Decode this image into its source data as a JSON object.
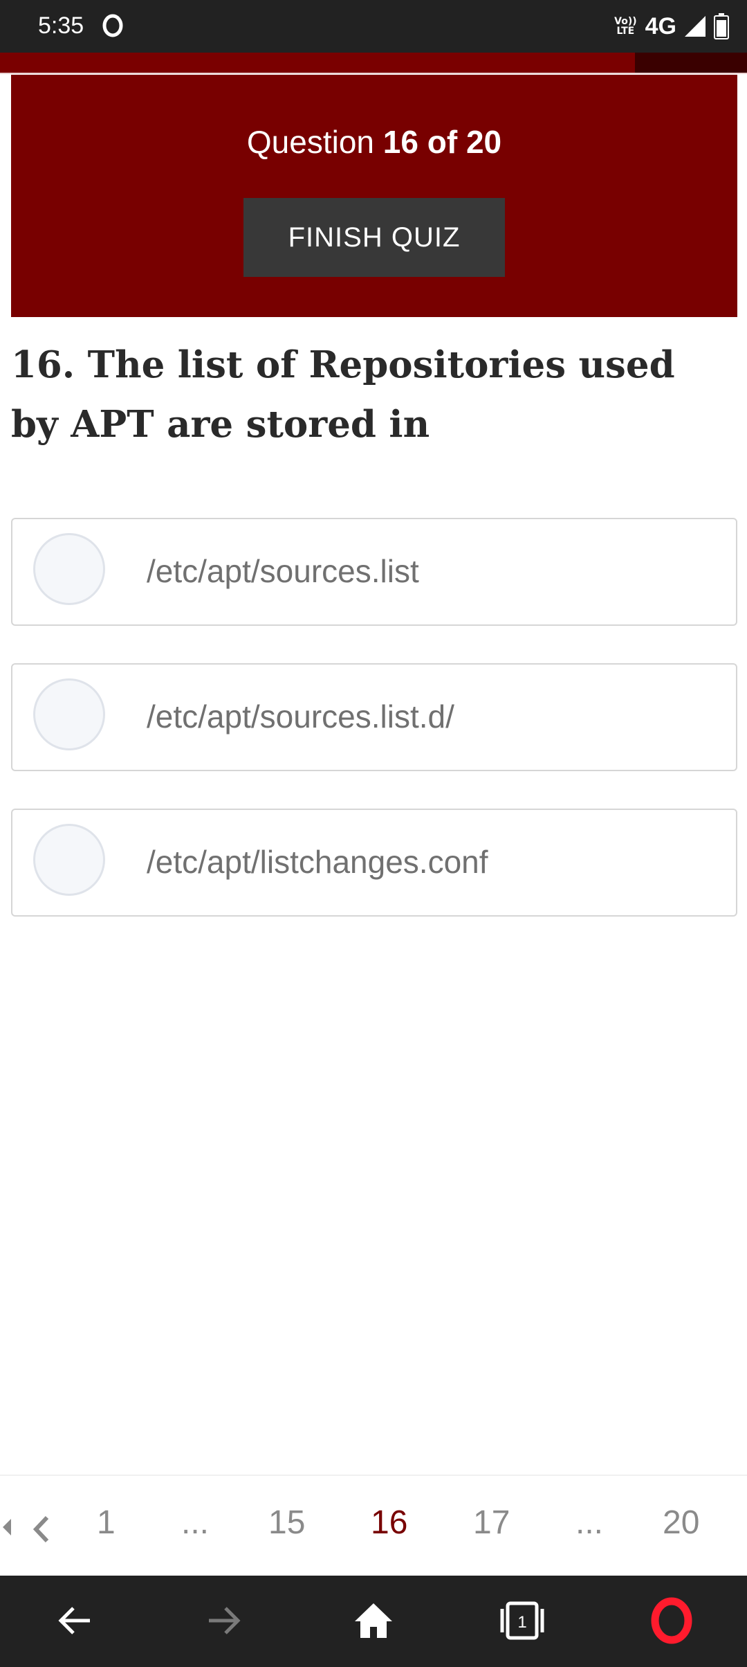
{
  "status_bar": {
    "time": "5:35",
    "volte_line1": "Vo))",
    "volte_line2": "LTE",
    "network": "4G"
  },
  "progress": {
    "fraction": 0.85
  },
  "quiz_header": {
    "question_prefix": "Question",
    "question_position": "16 of 20",
    "finish_label": "FINISH QUIZ"
  },
  "question": {
    "text": "16. The list of Repositories used by APT are stored in"
  },
  "options": [
    {
      "label": "/etc/apt/sources.list"
    },
    {
      "label": "/etc/apt/sources.list.d/"
    },
    {
      "label": "/etc/apt/listchanges.conf"
    }
  ],
  "pagination": {
    "items": [
      "1",
      "...",
      "15",
      "16",
      "17",
      "...",
      "20"
    ],
    "active": "16"
  },
  "colors": {
    "accent": "#780000",
    "status_bar": "#222222",
    "button": "#383838"
  },
  "bottom_nav": {
    "tabs_count": "1"
  }
}
